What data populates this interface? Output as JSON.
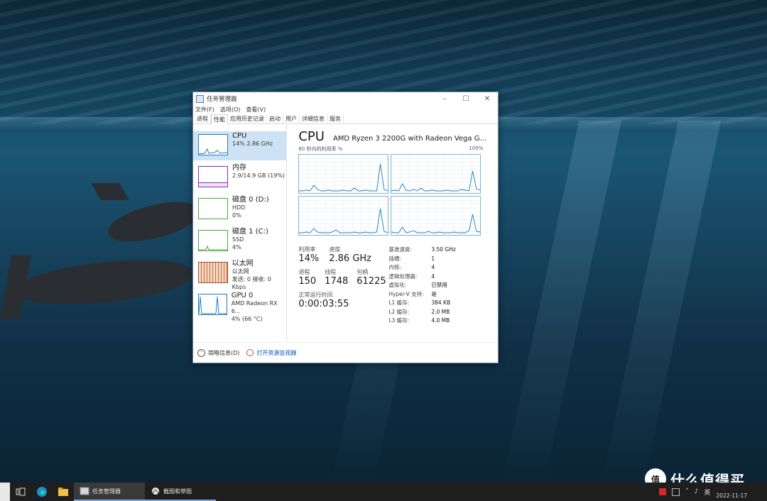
{
  "window": {
    "title": "任务管理器"
  },
  "menu": [
    "文件(F)",
    "选项(O)",
    "查看(V)"
  ],
  "tabs": [
    "进程",
    "性能",
    "应用历史记录",
    "启动",
    "用户",
    "详细信息",
    "服务"
  ],
  "sidebar": [
    {
      "title": "CPU",
      "sub1": "14% 2.86 GHz",
      "sub2": "",
      "color": "#1f7cc1"
    },
    {
      "title": "内存",
      "sub1": "2.9/14.9 GB (19%)",
      "sub2": "",
      "color": "#8b29b0"
    },
    {
      "title": "磁盘 0 (D:)",
      "sub1": "HDD",
      "sub2": "0%",
      "color": "#4aa83a"
    },
    {
      "title": "磁盘 1 (C:)",
      "sub1": "SSD",
      "sub2": "4%",
      "color": "#4aa83a"
    },
    {
      "title": "以太网",
      "sub1": "以太网",
      "sub2": "发送: 0 接收: 0 Kbps",
      "color": "#a0522d"
    },
    {
      "title": "GPU 0",
      "sub1": "AMD Radeon RX 6...",
      "sub2": "4% (66 °C)",
      "color": "#1f7cc1"
    }
  ],
  "cpu": {
    "title": "CPU",
    "model": "AMD Ryzen 3 2200G with Radeon Vega G...",
    "graph_label_left": "60 秒内的利用率 %",
    "graph_label_right": "100%",
    "utilization_label": "利用率",
    "utilization": "14%",
    "speed_label": "速度",
    "speed": "2.86 GHz",
    "processes_label": "进程",
    "processes": "150",
    "threads_label": "线程",
    "threads": "1748",
    "handles_label": "句柄",
    "handles": "61225",
    "uptime_label": "正常运行时间",
    "uptime": "0:00:03:55",
    "specs": [
      {
        "k": "基准速度:",
        "v": "3.50 GHz"
      },
      {
        "k": "插槽:",
        "v": "1"
      },
      {
        "k": "内核:",
        "v": "4"
      },
      {
        "k": "逻辑处理器:",
        "v": "4"
      },
      {
        "k": "虚拟化:",
        "v": "已禁用"
      },
      {
        "k": "Hyper-V 支持:",
        "v": "是"
      },
      {
        "k": "L1 缓存:",
        "v": "384 KB"
      },
      {
        "k": "L2 缓存:",
        "v": "2.0 MB"
      },
      {
        "k": "L3 缓存:",
        "v": "4.0 MB"
      }
    ]
  },
  "footer": {
    "brief": "简略信息(D)",
    "monitor": "打开资源监视器"
  },
  "taskbar": {
    "apps": [
      "任务管理器",
      "截图和草图"
    ],
    "lang": "英",
    "date": "2022-11-17"
  },
  "watermark": {
    "badge": "值",
    "text": "什么值得买"
  }
}
